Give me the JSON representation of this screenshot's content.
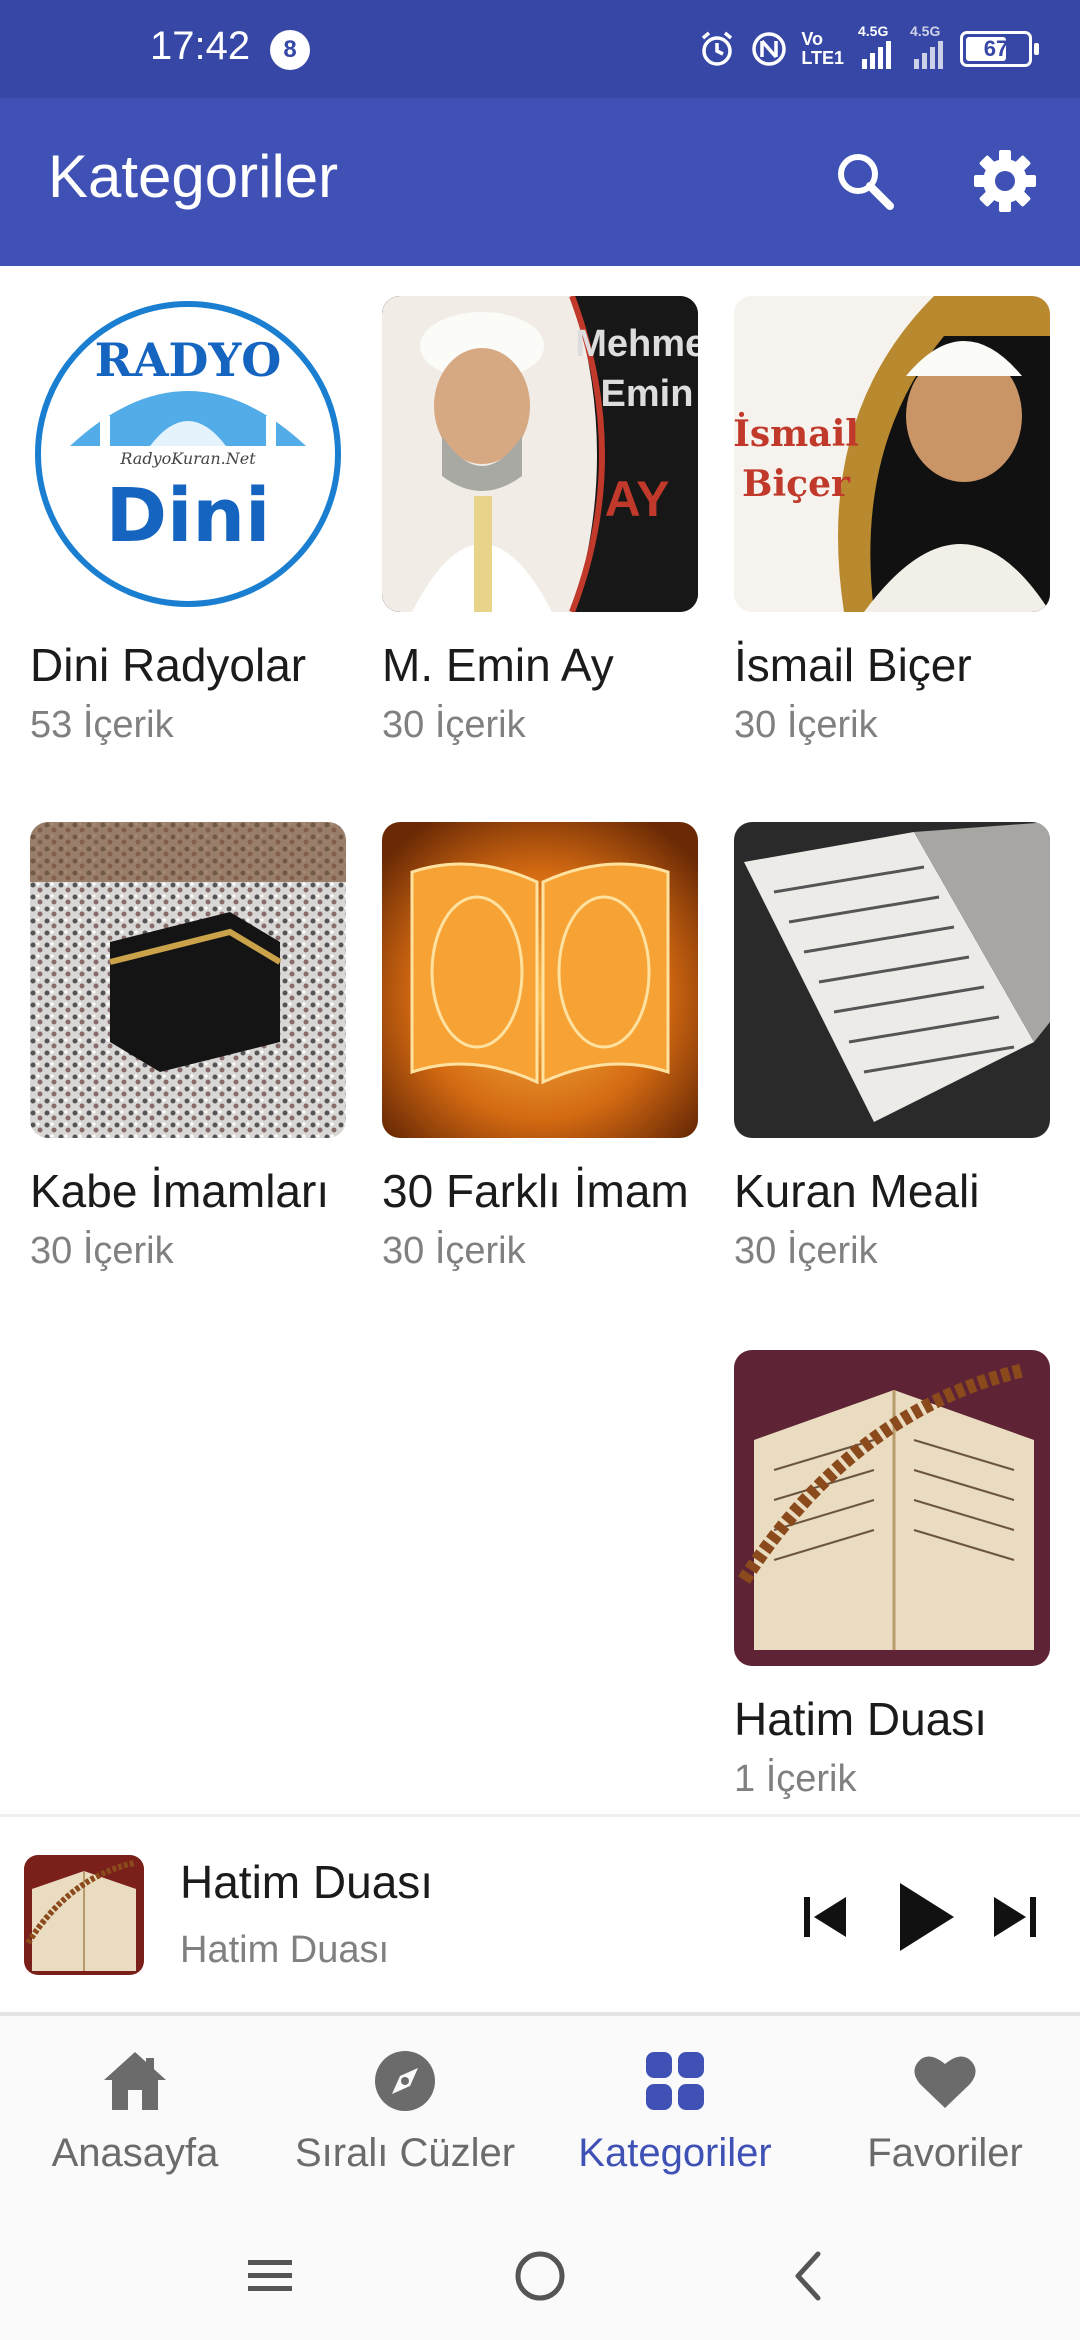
{
  "status_bar": {
    "time": "17:42",
    "notification_count": "8",
    "network_label_1": "Vo",
    "network_label_2": "LTE1",
    "signal_1": "4.5G",
    "signal_2": "4.5G",
    "battery": "67"
  },
  "app_bar": {
    "title": "Kategoriler"
  },
  "categories": [
    {
      "title": "Dini Radyolar",
      "count": "53 İçerik",
      "logo_top": "RADYO",
      "logo_mid": "RadyoKuran.Net",
      "logo_main": "Dini"
    },
    {
      "title": "M. Emin Ay",
      "count": "30 İçerik",
      "overlay": [
        "Mehmet",
        "Emin",
        "AY"
      ]
    },
    {
      "title": "İsmail Biçer",
      "count": "30 İçerik",
      "overlay": [
        "İsmail",
        "Biçer"
      ]
    },
    {
      "title": "Kabe İmamları",
      "count": "30 İçerik"
    },
    {
      "title": "30 Farklı İmam",
      "count": "30 İçerik"
    },
    {
      "title": "Kuran Meali",
      "count": "30 İçerik"
    },
    {
      "title": "Hatim Duası",
      "count": "1 İçerik"
    }
  ],
  "player": {
    "title": "Hatim Duası",
    "subtitle": "Hatim Duası"
  },
  "bottom_nav": [
    {
      "label": "Anasayfa",
      "icon": "home-icon",
      "active": false
    },
    {
      "label": "Sıralı Cüzler",
      "icon": "compass-icon",
      "active": false
    },
    {
      "label": "Kategoriler",
      "icon": "grid-icon",
      "active": true
    },
    {
      "label": "Favoriler",
      "icon": "heart-icon",
      "active": false
    }
  ],
  "colors": {
    "primary": "#3f51b5",
    "status_bar": "#3747a6",
    "inactive": "#6b6b6b",
    "subtext": "#808080"
  }
}
